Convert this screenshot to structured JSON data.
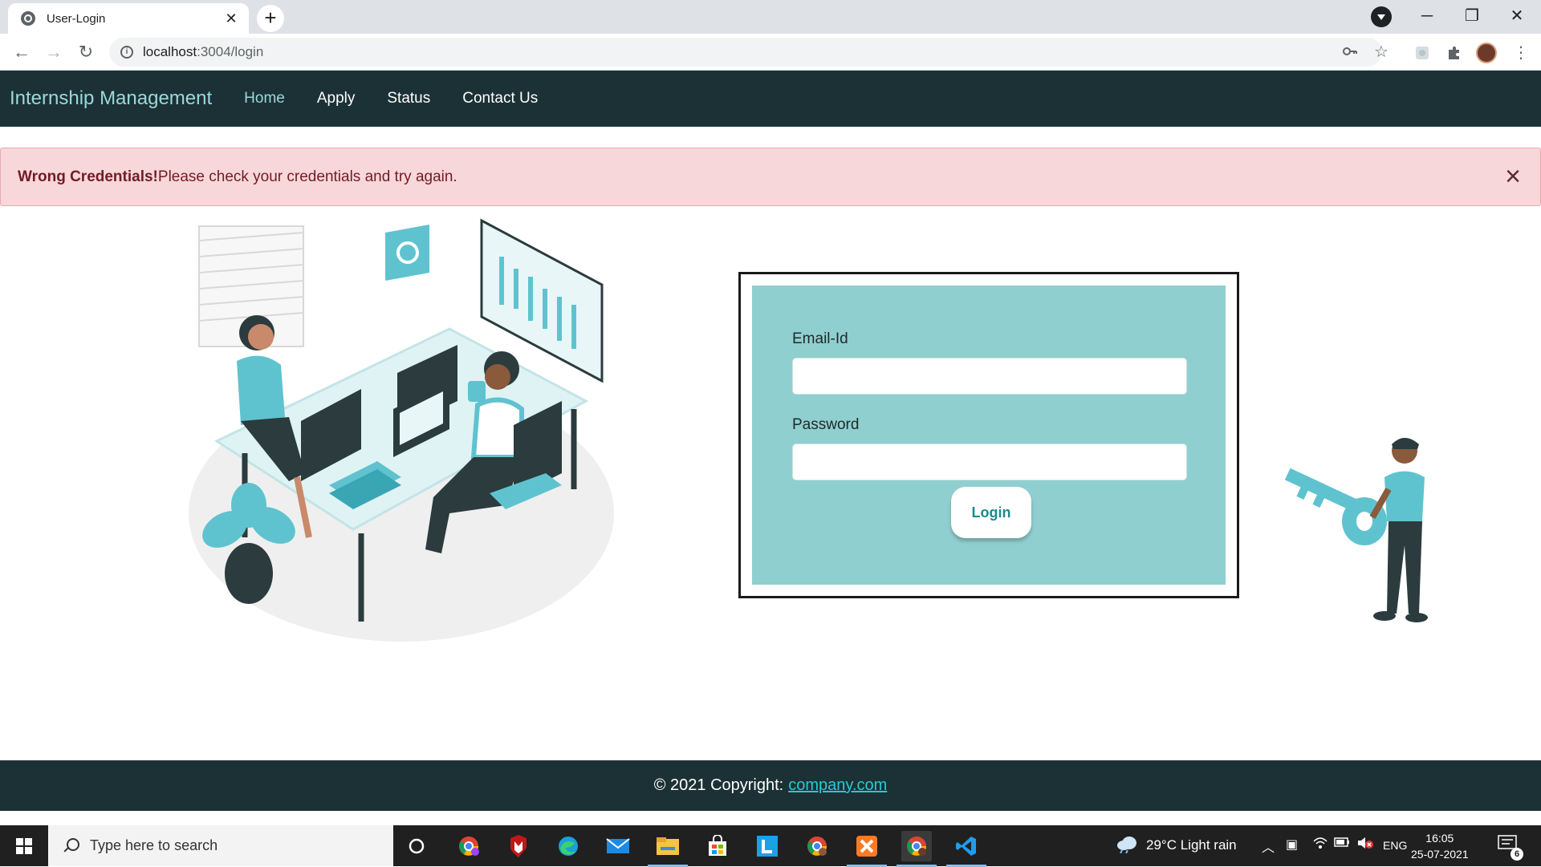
{
  "browser": {
    "tab_title": "User-Login",
    "tab_close": "✕",
    "new_tab": "+",
    "url_host": "localhost",
    "url_path": ":3004/login",
    "window_controls": {
      "minimize": "─",
      "maximize": "❐",
      "close": "✕"
    }
  },
  "site": {
    "brand": "Internship Management",
    "nav": [
      {
        "label": "Home",
        "active": true
      },
      {
        "label": "Apply",
        "active": false
      },
      {
        "label": "Status",
        "active": false
      },
      {
        "label": "Contact Us",
        "active": false
      }
    ]
  },
  "alert": {
    "title": "Wrong Credentials!",
    "message": "Please check your credentials and try again.",
    "close_icon": "×"
  },
  "login_form": {
    "email_label": "Email-Id",
    "email_value": "",
    "password_label": "Password",
    "password_value": "",
    "submit_label": "Login"
  },
  "footer": {
    "text": "© 2021 Copyright:",
    "link": "company.com"
  },
  "taskbar": {
    "search_placeholder": "Type here to search",
    "weather": "29°C  Light rain",
    "language": "ENG",
    "time": "16:05",
    "date": "25-07-2021",
    "notifications": "6"
  },
  "colors": {
    "nav_bg": "#1c3135",
    "brand": "#9ad8dd",
    "alert_bg": "#f8d7da",
    "alert_text": "#721c24",
    "form_bg": "#90cfcf",
    "button_text": "#1a8a8e",
    "footer_link": "#29c9d6"
  }
}
